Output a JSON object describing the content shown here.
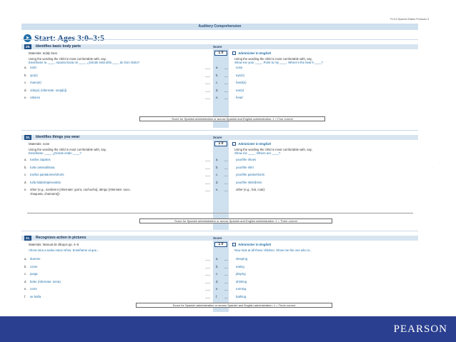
{
  "page": {
    "header_right": "PLS-5 Spanish Edition  Protocolo  3",
    "section_title": "Auditory Comprehension",
    "start_label": "Start: Ages 3:0–3:5",
    "right_mark": "·"
  },
  "score_label": "Score",
  "score_values": "1  0",
  "administer_label": "Administer in English",
  "items": [
    {
      "number": "29.",
      "title": "Identifies basic body parts",
      "materials": "Materials: teddy bear",
      "instruction_left": "Using the wording the child is most comfortable with, say,",
      "prompt_left": "Enséñame tu ____.    Apunta hacia mi ____.    ¿Dónde está el/la ____ de Don Osito?",
      "instruction_right": "Using the wording the child is most comfortable with, say,",
      "prompt_right": "Show me your ____.    Point to my ____.    Where's the bear's ____?",
      "left_options": [
        {
          "letter": "a.",
          "text": "nariz"
        },
        {
          "letter": "b.",
          "text": "ojo(s)"
        },
        {
          "letter": "c.",
          "text": "mano(s)"
        },
        {
          "letter": "d.",
          "text": "oído(s) (Alternate: oreja[s])"
        },
        {
          "letter": "e.",
          "text": "cabeza"
        }
      ],
      "right_options": [
        {
          "letter": "a.",
          "text": "nose"
        },
        {
          "letter": "b.",
          "text": "eye(s)"
        },
        {
          "letter": "c.",
          "text": "hand(s)"
        },
        {
          "letter": "d.",
          "text": "ear(s)"
        },
        {
          "letter": "e.",
          "text": "head"
        }
      ],
      "score_note": "Score for Spanish administration or across Spanish and English administration: 1 = Four correct"
    },
    {
      "number": "30.",
      "title": "Identifies things you wear",
      "materials": "Materials: none",
      "instruction_left": "Using the wording the child is most comfortable with, say,",
      "prompt_left": "Enséñame ____.    ¿Dónde están ____?",
      "instruction_right": "Using the wording the child is most comfortable with, say,",
      "prompt_right": "Show me ____.    Where are ____?",
      "left_options": [
        {
          "letter": "a.",
          "text": "tus/los zapatos"
        },
        {
          "letter": "b.",
          "text": "tu/la camisa/blusa"
        },
        {
          "letter": "c.",
          "text": "tus/los pantalones/shorts"
        },
        {
          "letter": "d.",
          "text": "tu/la falda/traje/vestido"
        },
        {
          "letter": "e.",
          "text": "other (e.g., sombrero [Alternate: gorra, cachucha], abrigo [Alternate: saco,"
        },
        {
          "letter": "",
          "text": "chaqueta, chamarra]):"
        }
      ],
      "right_options": [
        {
          "letter": "a.",
          "text": "your/the shoes"
        },
        {
          "letter": "b.",
          "text": "your/the shirt"
        },
        {
          "letter": "c.",
          "text": "your/the pants/shorts"
        },
        {
          "letter": "d.",
          "text": "your/the skirt/dress"
        },
        {
          "letter": "e.",
          "text": "other (e.g., hat, coat):"
        }
      ],
      "score_note": "Score for Spanish administration or across Spanish and English administration: 1 = Three correct"
    },
    {
      "number": "31.",
      "title": "Recognizes action in pictures",
      "materials": "Materials: Manual de dibujos pp. 4–5",
      "instruction_left": "Ahora mira a todos estos niños. Enséñame al que...",
      "prompt_left": "",
      "instruction_right": "Now look at all these children. Show me the one who is...",
      "prompt_right": "",
      "left_options": [
        {
          "letter": "a.",
          "text": "duerme"
        },
        {
          "letter": "b.",
          "text": "come"
        },
        {
          "letter": "c.",
          "text": "juega"
        },
        {
          "letter": "d.",
          "text": "bebe (Alternate: toma)"
        },
        {
          "letter": "e.",
          "text": "corre"
        },
        {
          "letter": "f.",
          "text": "se baña"
        }
      ],
      "right_options": [
        {
          "letter": "a.",
          "text": "sleeping"
        },
        {
          "letter": "b.",
          "text": "eating"
        },
        {
          "letter": "c.",
          "text": "playing"
        },
        {
          "letter": "d.",
          "text": "drinking"
        },
        {
          "letter": "e.",
          "text": "running"
        },
        {
          "letter": "f.",
          "text": "bathing"
        }
      ],
      "score_note": "Score for Spanish administration or across Spanish and English administration: 1 = Three correct"
    }
  ],
  "footer": {
    "logo": "PEARSON",
    "color": "#2a3f8f"
  }
}
